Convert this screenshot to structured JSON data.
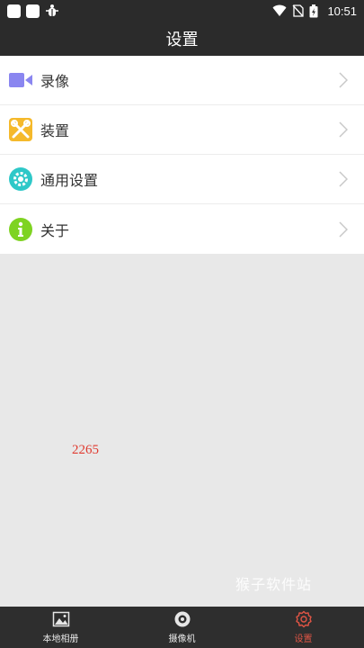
{
  "status_bar": {
    "time": "10:51"
  },
  "header": {
    "title": "设置"
  },
  "menu": {
    "items": [
      {
        "label": "录像",
        "icon": "video-camera-icon",
        "color": "#8a86f0"
      },
      {
        "label": "装置",
        "icon": "tools-icon",
        "color": "#f5b92b"
      },
      {
        "label": "通用设置",
        "icon": "gear-icon",
        "color": "#2ec8c8"
      },
      {
        "label": "关于",
        "icon": "info-icon",
        "color": "#7ed321"
      }
    ]
  },
  "overlay": {
    "number": "2265"
  },
  "watermark": {
    "text": "猴子软件站"
  },
  "bottom_nav": {
    "active_color": "#e05545",
    "tabs": [
      {
        "label": "本地相册",
        "icon": "image-icon",
        "active": false
      },
      {
        "label": "摄像机",
        "icon": "camera-lens-icon",
        "active": false
      },
      {
        "label": "设置",
        "icon": "settings-gear-icon",
        "active": true
      }
    ]
  }
}
